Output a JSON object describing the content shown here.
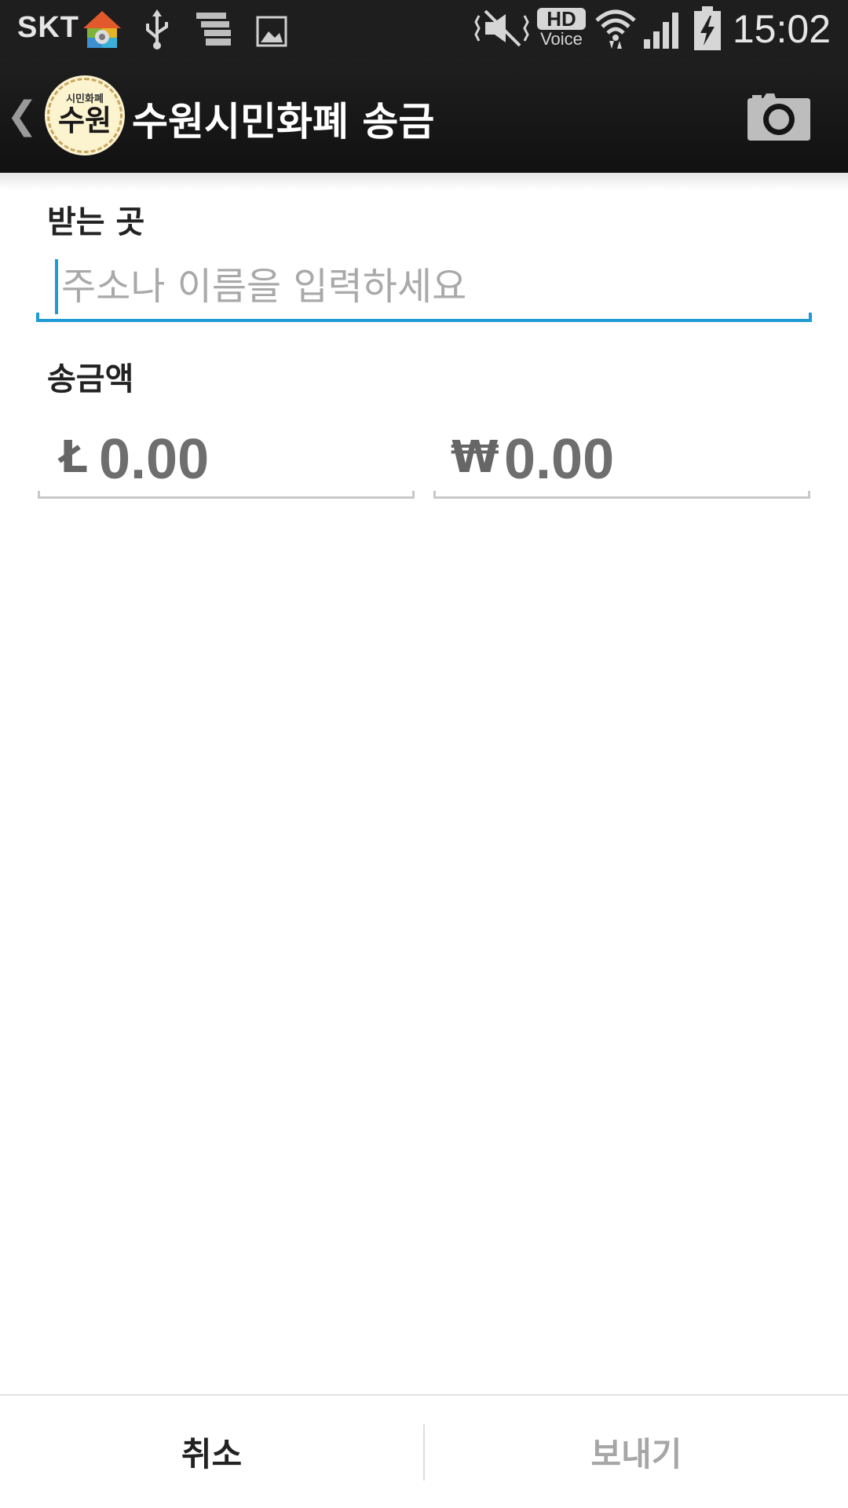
{
  "status_bar": {
    "carrier": "SKT",
    "time": "15:02",
    "icons": [
      "home-settings-icon",
      "usb-icon",
      "stack-icon",
      "image-icon",
      "vibrate-mute-icon",
      "hd-voice-icon",
      "wifi-icon",
      "signal-icon",
      "battery-charging-icon"
    ],
    "hd_voice_top": "HD",
    "hd_voice_bottom": "Voice"
  },
  "action_bar": {
    "logo_small": "시민화폐",
    "logo_big": "수원",
    "title": "수원시민화폐 송금",
    "camera_icon": "camera-icon"
  },
  "form": {
    "recipient_label": "받는 곳",
    "recipient_placeholder": "주소나 이름을 입력하세요",
    "recipient_value": "",
    "amount_label": "송금액",
    "amount_coin_symbol": "Ł",
    "amount_coin_value": "0.00",
    "amount_krw_symbol": "₩",
    "amount_krw_value": "0.00"
  },
  "bottom_bar": {
    "cancel_label": "취소",
    "send_label": "보내기"
  },
  "colors": {
    "accent": "#1e9ad6",
    "status_bar_bg": "#1e1e1e",
    "action_bar_bg": "#151515",
    "disabled_text": "#a6a6a6"
  }
}
